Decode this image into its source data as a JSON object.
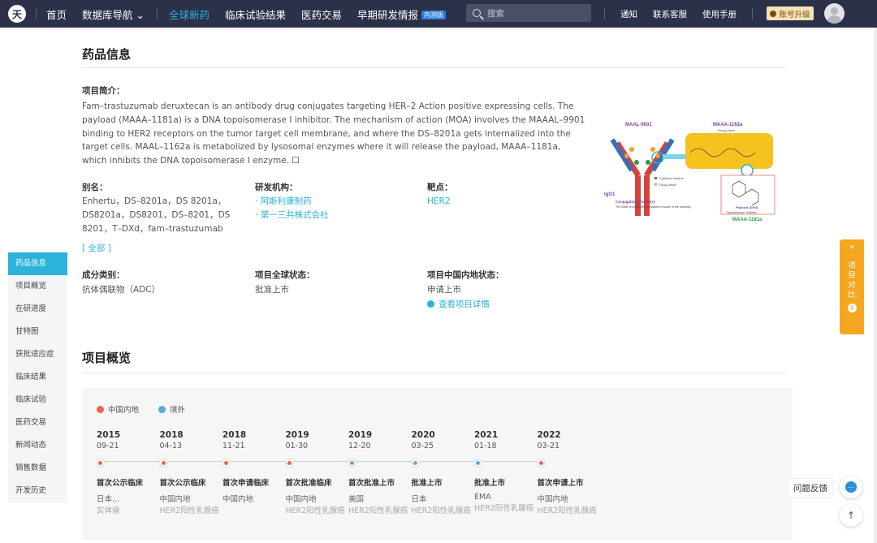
{
  "header": {
    "logo_text": "天",
    "nav": [
      "首页",
      "数据库导航 ⌄",
      "全球新药",
      "临床试验结果",
      "医药交易",
      "早期研发情报"
    ],
    "nav_badge": "内测版",
    "search_placeholder": "搜索",
    "right_nav": [
      "通知",
      "联系客服",
      "使用手册"
    ],
    "upgrade": "账号升级"
  },
  "sidebar": [
    {
      "label": "药品信息",
      "active": true
    },
    {
      "label": "项目概览"
    },
    {
      "label": "在研进度"
    },
    {
      "label": "甘特图"
    },
    {
      "label": "获批适应症"
    },
    {
      "label": "临床结果"
    },
    {
      "label": "临床试验"
    },
    {
      "label": "医药交易"
    },
    {
      "label": "新闻动态"
    },
    {
      "label": "销售数据"
    },
    {
      "label": "开发历史"
    }
  ],
  "drug_info": {
    "title": "药品信息",
    "intro_label": "项目简介：",
    "intro": "Fam–trastuzumab deruxtecan is an antibody drug conjugates targeting HER–2 Action positive expressing cells. The payload (MAAA–1181a) is a DNA topoisomerase I inhibitor. The mechanism of action (MOA) involves the MAAAL–9901 binding to HER2 receptors on the tumor target cell membrane, and where the DS–8201a gets internalized into the target cells. MAAL–1162a is metabolized by lysosomal enzymes where it will release the payload, MAAA–1181a, which inhibits the DNA topoisomerase I enzyme.",
    "alias_label": "别名：",
    "alias": "Enhertu，DS–8201a，DS 8201a，DS8201a，DS8201，DS–8201，DS 8201，T–DXd，fam–trastuzumab",
    "more": "[ 全部 ]",
    "org_label": "研发机构：",
    "orgs": [
      "阿斯利康制药",
      "第一三共株式会社"
    ],
    "target_label": "靶点：",
    "target": "HER2",
    "type_label": "成分类别：",
    "type": "抗体偶联物（ADC）",
    "global_status_label": "项目全球状态：",
    "global_status": "批准上市",
    "china_status_label": "项目中国内地状态：",
    "china_status": "申请上市",
    "detail_link": "查看项目详情"
  },
  "mechanism_image": {
    "maal9001": "MAAL-9001",
    "maaa1162a": "MAAA-1162a",
    "drug_linker": "Drug-Linker",
    "cysteine": "Cysteine residue",
    "drug_linker2": "Drug-Linker",
    "igg1": "IgG1",
    "conj_title": "Conjugation chemistry",
    "conj_desc": "The linker is connected to cysteine residue of the antibody",
    "payload_title": "Payload (DXd)",
    "payload_desc": "Topoisomerase I inhibitor",
    "maaa1181a": "MAAA-1181a"
  },
  "overview": {
    "title": "项目概览",
    "legend": [
      {
        "label": "中国内地",
        "color": "#f0624d"
      },
      {
        "label": "境外",
        "color": "#5aaad6"
      }
    ],
    "events": [
      {
        "year": "2015",
        "md": "09-21",
        "color": "#f0624d",
        "title": "首次公示临床",
        "s1": "日本...",
        "s2": "实体瘤"
      },
      {
        "year": "2018",
        "md": "04-13",
        "color": "#f0624d",
        "title": "首次公示临床",
        "s1": "中国内地",
        "s2": "HER2阳性乳腺癌"
      },
      {
        "year": "2018",
        "md": "11-21",
        "color": "#f0624d",
        "title": "首次申请临床",
        "s1": "中国内地",
        "s2": ""
      },
      {
        "year": "2019",
        "md": "01-30",
        "color": "#f0624d",
        "title": "首次批准临床",
        "s1": "中国内地",
        "s2": "HER2阳性乳腺癌"
      },
      {
        "year": "2019",
        "md": "12-20",
        "color": "#5aaad6",
        "title": "首次批准上市",
        "s1": "美国",
        "s2": "HER2阳性乳腺癌"
      },
      {
        "year": "2020",
        "md": "03-25",
        "color": "#5aaad6",
        "title": "批准上市",
        "s1": "日本",
        "s2": "HER2阳性乳腺癌"
      },
      {
        "year": "2021",
        "md": "01-18",
        "color": "#5aaad6",
        "title": "批准上市",
        "s1": "EMA",
        "s2": "HER2阳性乳腺癌"
      },
      {
        "year": "2022",
        "md": "03-21",
        "color": "#f0624d",
        "title": "首次申请上市",
        "s1": "中国内地",
        "s2": "HER2阳性乳腺癌"
      }
    ]
  },
  "float": {
    "compare_arrow": "«",
    "compare_label": "项目对比.",
    "compare_count": "4",
    "feedback": "问题反馈",
    "feedback_icon": "…",
    "top_icon": "↑"
  }
}
